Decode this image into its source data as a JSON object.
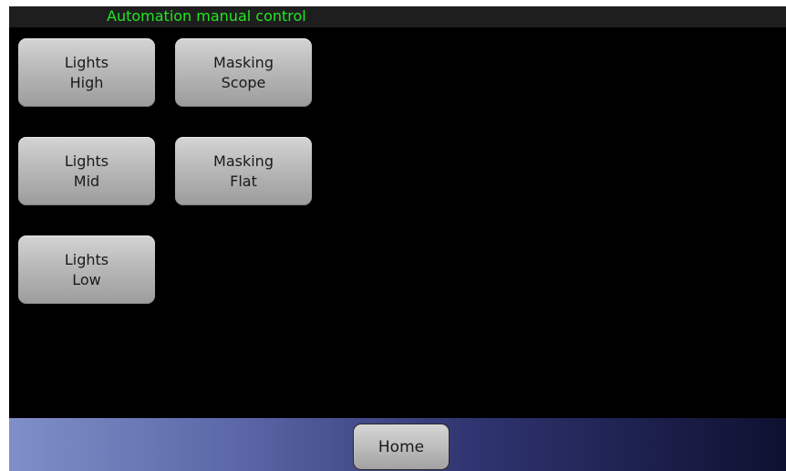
{
  "title_bar": {
    "title": "Automation manual control",
    "title_color": "#22e622"
  },
  "controls": {
    "lights_high": {
      "line1": "Lights",
      "line2": "High"
    },
    "lights_mid": {
      "line1": "Lights",
      "line2": "Mid"
    },
    "lights_low": {
      "line1": "Lights",
      "line2": "Low"
    },
    "masking_scope": {
      "line1": "Masking",
      "line2": "Scope"
    },
    "masking_flat": {
      "line1": "Masking",
      "line2": "Flat"
    }
  },
  "bottom_bar": {
    "home_label": "Home"
  }
}
